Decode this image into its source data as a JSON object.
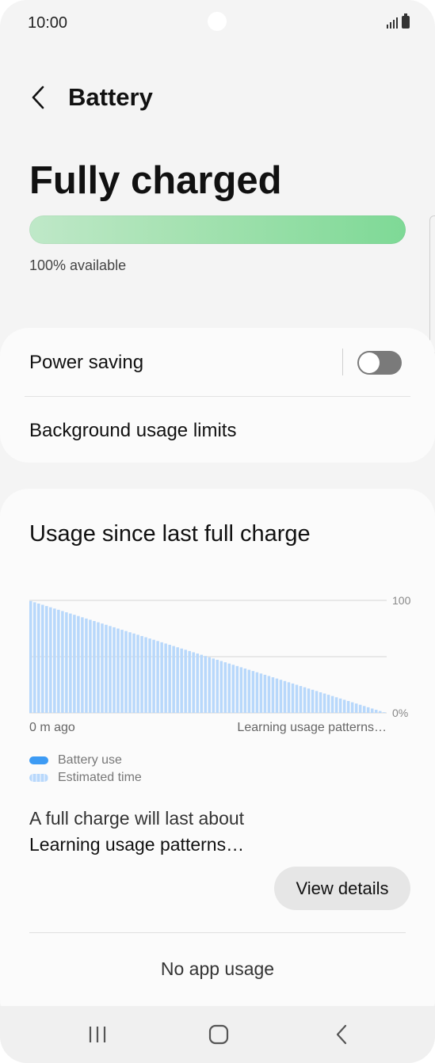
{
  "status_bar": {
    "time": "10:00",
    "icons": [
      "signal-icon",
      "battery-icon"
    ]
  },
  "header": {
    "title": "Battery",
    "back_icon": "chevron-left-icon"
  },
  "battery_status": {
    "headline": "Fully charged",
    "available_text": "100% available",
    "charge_level_percent": 100,
    "bar_color": "#7ed996"
  },
  "settings": {
    "power_saving_label": "Power saving",
    "power_saving_enabled": false,
    "background_limits_label": "Background usage limits"
  },
  "usage": {
    "title": "Usage since last full charge",
    "full_charge_label": "A full charge will last about",
    "full_charge_value": "Learning usage patterns…",
    "view_details_label": "View details",
    "no_app_usage": "No app usage"
  },
  "chart_data": {
    "type": "area",
    "series": [
      {
        "name": "Battery use",
        "color": "#3d9bf4",
        "x": [],
        "y": []
      },
      {
        "name": "Estimated time",
        "color": "#b8d8fb",
        "x": [
          0,
          1
        ],
        "y": [
          100,
          0
        ]
      }
    ],
    "y_tick_labels": [
      "100",
      "0%"
    ],
    "x_tick_labels": [
      "0 m ago",
      "Learning usage patterns…"
    ],
    "ylim": [
      0,
      100
    ],
    "grid": true,
    "legend": [
      "Battery use",
      "Estimated time"
    ],
    "legend_position": "bottom-left"
  },
  "nav_bar": {
    "recents_icon": "recents-icon",
    "home_icon": "home-icon",
    "back_icon": "back-icon"
  }
}
